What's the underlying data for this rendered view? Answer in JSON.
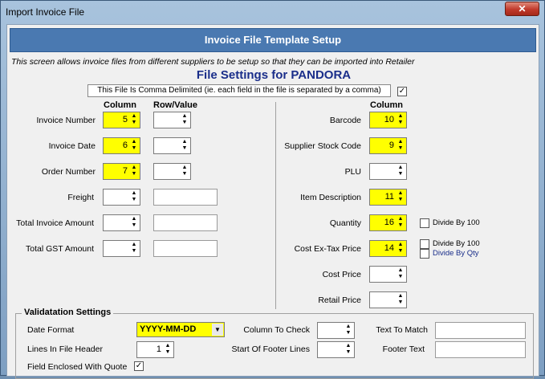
{
  "window": {
    "title": "Import Invoice File",
    "close_label": "✕"
  },
  "banner": "Invoice File Template Setup",
  "intro": "This screen allows invoice files from different suppliers to be setup so that they can be imported into Retailer",
  "heading": "File Settings for PANDORA",
  "comma_delimited": {
    "label": "This File Is Comma Delimited (ie. each field in the file is separated by a comma)",
    "checked": "✓"
  },
  "left": {
    "column_header": "Column",
    "row_header": "Row/Value",
    "invoice_number": {
      "label": "Invoice Number",
      "column": "5"
    },
    "invoice_date": {
      "label": "Invoice Date",
      "column": "6"
    },
    "order_number": {
      "label": "Order Number",
      "column": "7"
    },
    "freight": {
      "label": "Freight",
      "column": ""
    },
    "total_invoice_amount": {
      "label": "Total Invoice Amount",
      "column": ""
    },
    "total_gst_amount": {
      "label": "Total GST Amount",
      "column": ""
    }
  },
  "right": {
    "column_header": "Column",
    "barcode": {
      "label": "Barcode",
      "column": "10"
    },
    "supplier_stock_code": {
      "label": "Supplier Stock Code",
      "column": "9"
    },
    "plu": {
      "label": "PLU",
      "column": ""
    },
    "item_description": {
      "label": "Item Description",
      "column": "11"
    },
    "quantity": {
      "label": "Quantity",
      "column": "16",
      "divide_by_100": "Divide By 100"
    },
    "cost_ex_tax_price": {
      "label": "Cost Ex-Tax Price",
      "column": "14",
      "divide_by_100": "Divide By 100",
      "divide_by_qty": "Divide By Qty"
    },
    "cost_price": {
      "label": "Cost Price",
      "column": ""
    },
    "retail_price": {
      "label": "Retail Price",
      "column": ""
    }
  },
  "validation": {
    "title": "Validatation Settings",
    "date_format_label": "Date Format",
    "date_format_value": "YYYY-MM-DD",
    "lines_in_header_label": "Lines In File Header",
    "lines_in_header_value": "1",
    "field_enclosed_label": "Field Enclosed With Quote",
    "field_enclosed_checked": "✓",
    "column_to_check_label": "Column To Check",
    "start_footer_label": "Start Of Footer Lines",
    "text_to_match_label": "Text To Match",
    "footer_text_label": "Footer Text"
  },
  "colors": {
    "banner": "#4a79b1",
    "highlight": "#ffff00",
    "heading": "#1a2e8a",
    "divide_qty": "#1a2e8a"
  }
}
